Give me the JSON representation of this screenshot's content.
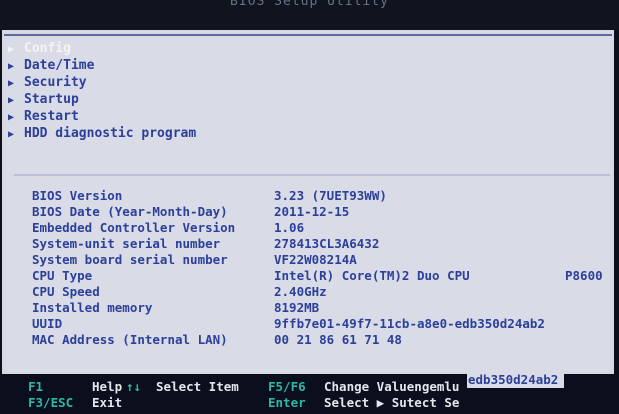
{
  "title": "BIOS Setup Utility",
  "menu": [
    {
      "label": "Config",
      "selected": true
    },
    {
      "label": "Date/Time",
      "selected": false
    },
    {
      "label": "Security",
      "selected": false
    },
    {
      "label": "Startup",
      "selected": false
    },
    {
      "label": "Restart",
      "selected": false
    },
    {
      "label": "HDD diagnostic program",
      "selected": false
    }
  ],
  "info": [
    {
      "label": "BIOS Version",
      "value": "3.23  (7UET93WW)"
    },
    {
      "label": "BIOS Date (Year-Month-Day)",
      "value": "2011-12-15"
    },
    {
      "label": "Embedded Controller Version",
      "value": "1.06"
    },
    {
      "label": "System-unit serial number",
      "value": "278413CL3A6432"
    },
    {
      "label": "System board serial number",
      "value": "VF22W08214A"
    },
    {
      "label": "CPU Type",
      "value": "Intel(R) Core(TM)2 Duo CPU",
      "extra": "P8600"
    },
    {
      "label": "CPU Speed",
      "value": "2.40GHz"
    },
    {
      "label": "Installed memory",
      "value": "8192MB"
    },
    {
      "label": "UUID",
      "value": "9ffb7e01-49f7-11cb-a8e0-edb350d24ab2"
    },
    {
      "label": "MAC Address (Internal LAN)",
      "value": "00 21 86 61 71 48"
    }
  ],
  "overflow_text": "edb350d24ab2",
  "footer": {
    "row1": [
      {
        "key": "F1",
        "desc": "Help"
      },
      {
        "key": "↑↓",
        "desc": "Select Item"
      },
      {
        "key": "F5/F6",
        "desc": "Change Valuengemlu"
      }
    ],
    "row2": [
      {
        "key": "F3/ESC",
        "desc": "Exit"
      },
      {
        "key": "Enter",
        "desc": "Select ▶ Sutect Se"
      }
    ]
  }
}
